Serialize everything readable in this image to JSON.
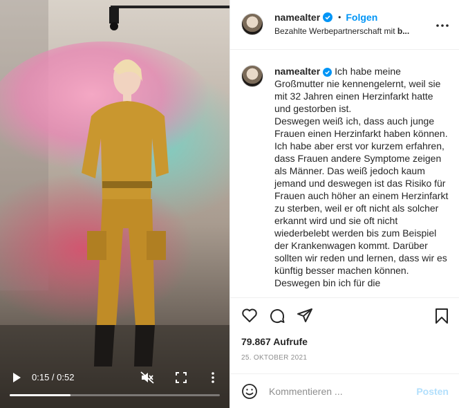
{
  "video": {
    "current_time": "0:15",
    "duration": "0:52",
    "time_separator": " / ",
    "progress": 0.29
  },
  "post": {
    "username": "namealter",
    "follow_label": "Folgen",
    "separator": "•",
    "sponsor_prefix": "Bezahlte Werbepartnerschaft mit ",
    "sponsor_partner": "b...",
    "caption": [
      "Ich habe meine Großmutter nie kennengelernt, weil sie mit 32 Jahren einen Herzinfarkt hatte und gestorben ist.",
      "Deswegen weiß ich, dass auch junge Frauen einen Herzinfarkt haben können. Ich habe aber erst vor kurzem erfahren, dass Frauen andere Symptome zeigen als Männer. Das weiß jedoch kaum jemand und deswegen ist das Risiko für Frauen auch höher an einem Herzinfarkt zu sterben, weil er oft nicht als solcher erkannt wird und sie oft nicht wiederbelebt werden bis zum Beispiel der Krankenwagen kommt. Darüber sollten wir reden und lernen, dass wir es künftig besser machen können.",
      "Deswegen bin ich für die"
    ],
    "views": "79.867 Aufrufe",
    "date": "25. OKTOBER 2021",
    "comment_placeholder": "Kommentieren ...",
    "post_label": "Posten"
  },
  "colors": {
    "accent": "#0095f6",
    "post_disabled": "#b2dffc",
    "muted": "#8e8e8e"
  },
  "icons": [
    "play-icon",
    "mute-icon",
    "fullscreen-icon",
    "more-vertical-icon",
    "verified-icon",
    "more-horizontal-icon",
    "heart-icon",
    "comment-icon",
    "share-icon",
    "bookmark-icon",
    "emoji-icon"
  ]
}
